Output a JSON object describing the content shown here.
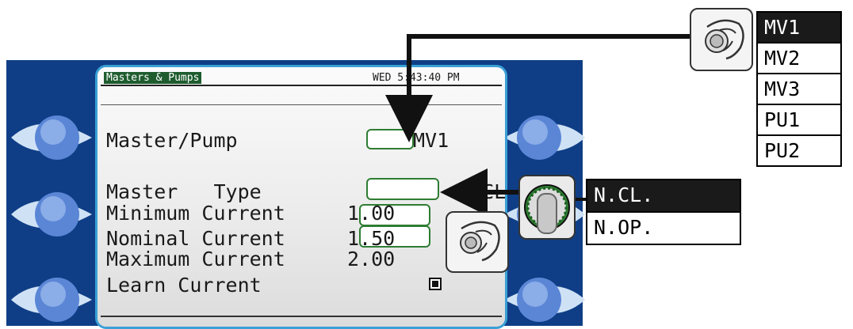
{
  "screen": {
    "title": "Masters & Pumps",
    "datetime": "WED 5:43:40 PM"
  },
  "rows": {
    "master_pump_label": "Master/Pump",
    "master_pump_value": "MV1",
    "master_type_label": "Master   Type",
    "master_type_value": "N.CL.",
    "min_current_label": "Minimum Current",
    "min_current_value": "1.00",
    "nom_current_label": "Nominal Current",
    "nom_current_value": "1.50",
    "max_current_label": "Maximum Current",
    "max_current_value": "2.00",
    "learn_current_label": "Learn Current"
  },
  "master_pump_options": [
    "MV1",
    "MV2",
    "MV3",
    "PU1",
    "PU2"
  ],
  "master_pump_selected": 0,
  "type_options": [
    "N.CL.",
    "N.OP."
  ],
  "type_selected": 0,
  "icons": [
    "hand-turn-icon",
    "rotary-knob-icon"
  ],
  "colors": {
    "bezel": "#0f3e86",
    "lcd_border": "#3aa0d6",
    "title_bg": "#1e5c2e",
    "field_border": "#2e7d32"
  }
}
